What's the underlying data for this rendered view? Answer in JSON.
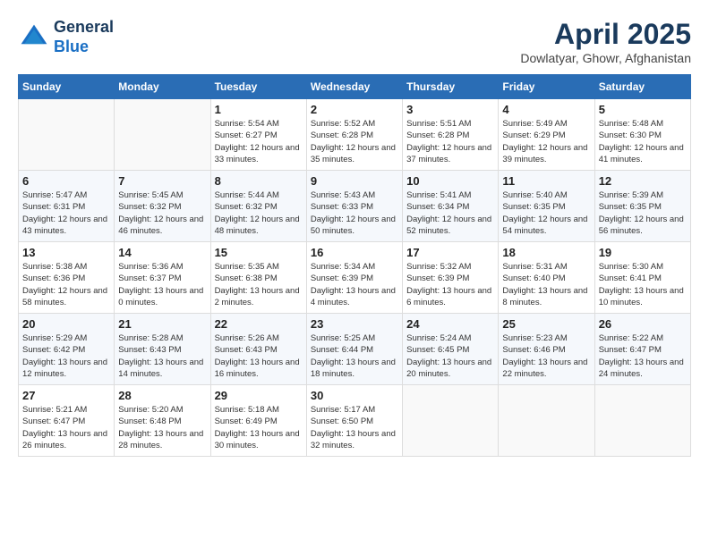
{
  "header": {
    "logo_line1": "General",
    "logo_line2": "Blue",
    "month": "April 2025",
    "location": "Dowlatyar, Ghowr, Afghanistan"
  },
  "weekdays": [
    "Sunday",
    "Monday",
    "Tuesday",
    "Wednesday",
    "Thursday",
    "Friday",
    "Saturday"
  ],
  "weeks": [
    [
      {
        "day": "",
        "sunrise": "",
        "sunset": "",
        "daylight": ""
      },
      {
        "day": "",
        "sunrise": "",
        "sunset": "",
        "daylight": ""
      },
      {
        "day": "1",
        "sunrise": "Sunrise: 5:54 AM",
        "sunset": "Sunset: 6:27 PM",
        "daylight": "Daylight: 12 hours and 33 minutes."
      },
      {
        "day": "2",
        "sunrise": "Sunrise: 5:52 AM",
        "sunset": "Sunset: 6:28 PM",
        "daylight": "Daylight: 12 hours and 35 minutes."
      },
      {
        "day": "3",
        "sunrise": "Sunrise: 5:51 AM",
        "sunset": "Sunset: 6:28 PM",
        "daylight": "Daylight: 12 hours and 37 minutes."
      },
      {
        "day": "4",
        "sunrise": "Sunrise: 5:49 AM",
        "sunset": "Sunset: 6:29 PM",
        "daylight": "Daylight: 12 hours and 39 minutes."
      },
      {
        "day": "5",
        "sunrise": "Sunrise: 5:48 AM",
        "sunset": "Sunset: 6:30 PM",
        "daylight": "Daylight: 12 hours and 41 minutes."
      }
    ],
    [
      {
        "day": "6",
        "sunrise": "Sunrise: 5:47 AM",
        "sunset": "Sunset: 6:31 PM",
        "daylight": "Daylight: 12 hours and 43 minutes."
      },
      {
        "day": "7",
        "sunrise": "Sunrise: 5:45 AM",
        "sunset": "Sunset: 6:32 PM",
        "daylight": "Daylight: 12 hours and 46 minutes."
      },
      {
        "day": "8",
        "sunrise": "Sunrise: 5:44 AM",
        "sunset": "Sunset: 6:32 PM",
        "daylight": "Daylight: 12 hours and 48 minutes."
      },
      {
        "day": "9",
        "sunrise": "Sunrise: 5:43 AM",
        "sunset": "Sunset: 6:33 PM",
        "daylight": "Daylight: 12 hours and 50 minutes."
      },
      {
        "day": "10",
        "sunrise": "Sunrise: 5:41 AM",
        "sunset": "Sunset: 6:34 PM",
        "daylight": "Daylight: 12 hours and 52 minutes."
      },
      {
        "day": "11",
        "sunrise": "Sunrise: 5:40 AM",
        "sunset": "Sunset: 6:35 PM",
        "daylight": "Daylight: 12 hours and 54 minutes."
      },
      {
        "day": "12",
        "sunrise": "Sunrise: 5:39 AM",
        "sunset": "Sunset: 6:35 PM",
        "daylight": "Daylight: 12 hours and 56 minutes."
      }
    ],
    [
      {
        "day": "13",
        "sunrise": "Sunrise: 5:38 AM",
        "sunset": "Sunset: 6:36 PM",
        "daylight": "Daylight: 12 hours and 58 minutes."
      },
      {
        "day": "14",
        "sunrise": "Sunrise: 5:36 AM",
        "sunset": "Sunset: 6:37 PM",
        "daylight": "Daylight: 13 hours and 0 minutes."
      },
      {
        "day": "15",
        "sunrise": "Sunrise: 5:35 AM",
        "sunset": "Sunset: 6:38 PM",
        "daylight": "Daylight: 13 hours and 2 minutes."
      },
      {
        "day": "16",
        "sunrise": "Sunrise: 5:34 AM",
        "sunset": "Sunset: 6:39 PM",
        "daylight": "Daylight: 13 hours and 4 minutes."
      },
      {
        "day": "17",
        "sunrise": "Sunrise: 5:32 AM",
        "sunset": "Sunset: 6:39 PM",
        "daylight": "Daylight: 13 hours and 6 minutes."
      },
      {
        "day": "18",
        "sunrise": "Sunrise: 5:31 AM",
        "sunset": "Sunset: 6:40 PM",
        "daylight": "Daylight: 13 hours and 8 minutes."
      },
      {
        "day": "19",
        "sunrise": "Sunrise: 5:30 AM",
        "sunset": "Sunset: 6:41 PM",
        "daylight": "Daylight: 13 hours and 10 minutes."
      }
    ],
    [
      {
        "day": "20",
        "sunrise": "Sunrise: 5:29 AM",
        "sunset": "Sunset: 6:42 PM",
        "daylight": "Daylight: 13 hours and 12 minutes."
      },
      {
        "day": "21",
        "sunrise": "Sunrise: 5:28 AM",
        "sunset": "Sunset: 6:43 PM",
        "daylight": "Daylight: 13 hours and 14 minutes."
      },
      {
        "day": "22",
        "sunrise": "Sunrise: 5:26 AM",
        "sunset": "Sunset: 6:43 PM",
        "daylight": "Daylight: 13 hours and 16 minutes."
      },
      {
        "day": "23",
        "sunrise": "Sunrise: 5:25 AM",
        "sunset": "Sunset: 6:44 PM",
        "daylight": "Daylight: 13 hours and 18 minutes."
      },
      {
        "day": "24",
        "sunrise": "Sunrise: 5:24 AM",
        "sunset": "Sunset: 6:45 PM",
        "daylight": "Daylight: 13 hours and 20 minutes."
      },
      {
        "day": "25",
        "sunrise": "Sunrise: 5:23 AM",
        "sunset": "Sunset: 6:46 PM",
        "daylight": "Daylight: 13 hours and 22 minutes."
      },
      {
        "day": "26",
        "sunrise": "Sunrise: 5:22 AM",
        "sunset": "Sunset: 6:47 PM",
        "daylight": "Daylight: 13 hours and 24 minutes."
      }
    ],
    [
      {
        "day": "27",
        "sunrise": "Sunrise: 5:21 AM",
        "sunset": "Sunset: 6:47 PM",
        "daylight": "Daylight: 13 hours and 26 minutes."
      },
      {
        "day": "28",
        "sunrise": "Sunrise: 5:20 AM",
        "sunset": "Sunset: 6:48 PM",
        "daylight": "Daylight: 13 hours and 28 minutes."
      },
      {
        "day": "29",
        "sunrise": "Sunrise: 5:18 AM",
        "sunset": "Sunset: 6:49 PM",
        "daylight": "Daylight: 13 hours and 30 minutes."
      },
      {
        "day": "30",
        "sunrise": "Sunrise: 5:17 AM",
        "sunset": "Sunset: 6:50 PM",
        "daylight": "Daylight: 13 hours and 32 minutes."
      },
      {
        "day": "",
        "sunrise": "",
        "sunset": "",
        "daylight": ""
      },
      {
        "day": "",
        "sunrise": "",
        "sunset": "",
        "daylight": ""
      },
      {
        "day": "",
        "sunrise": "",
        "sunset": "",
        "daylight": ""
      }
    ]
  ]
}
